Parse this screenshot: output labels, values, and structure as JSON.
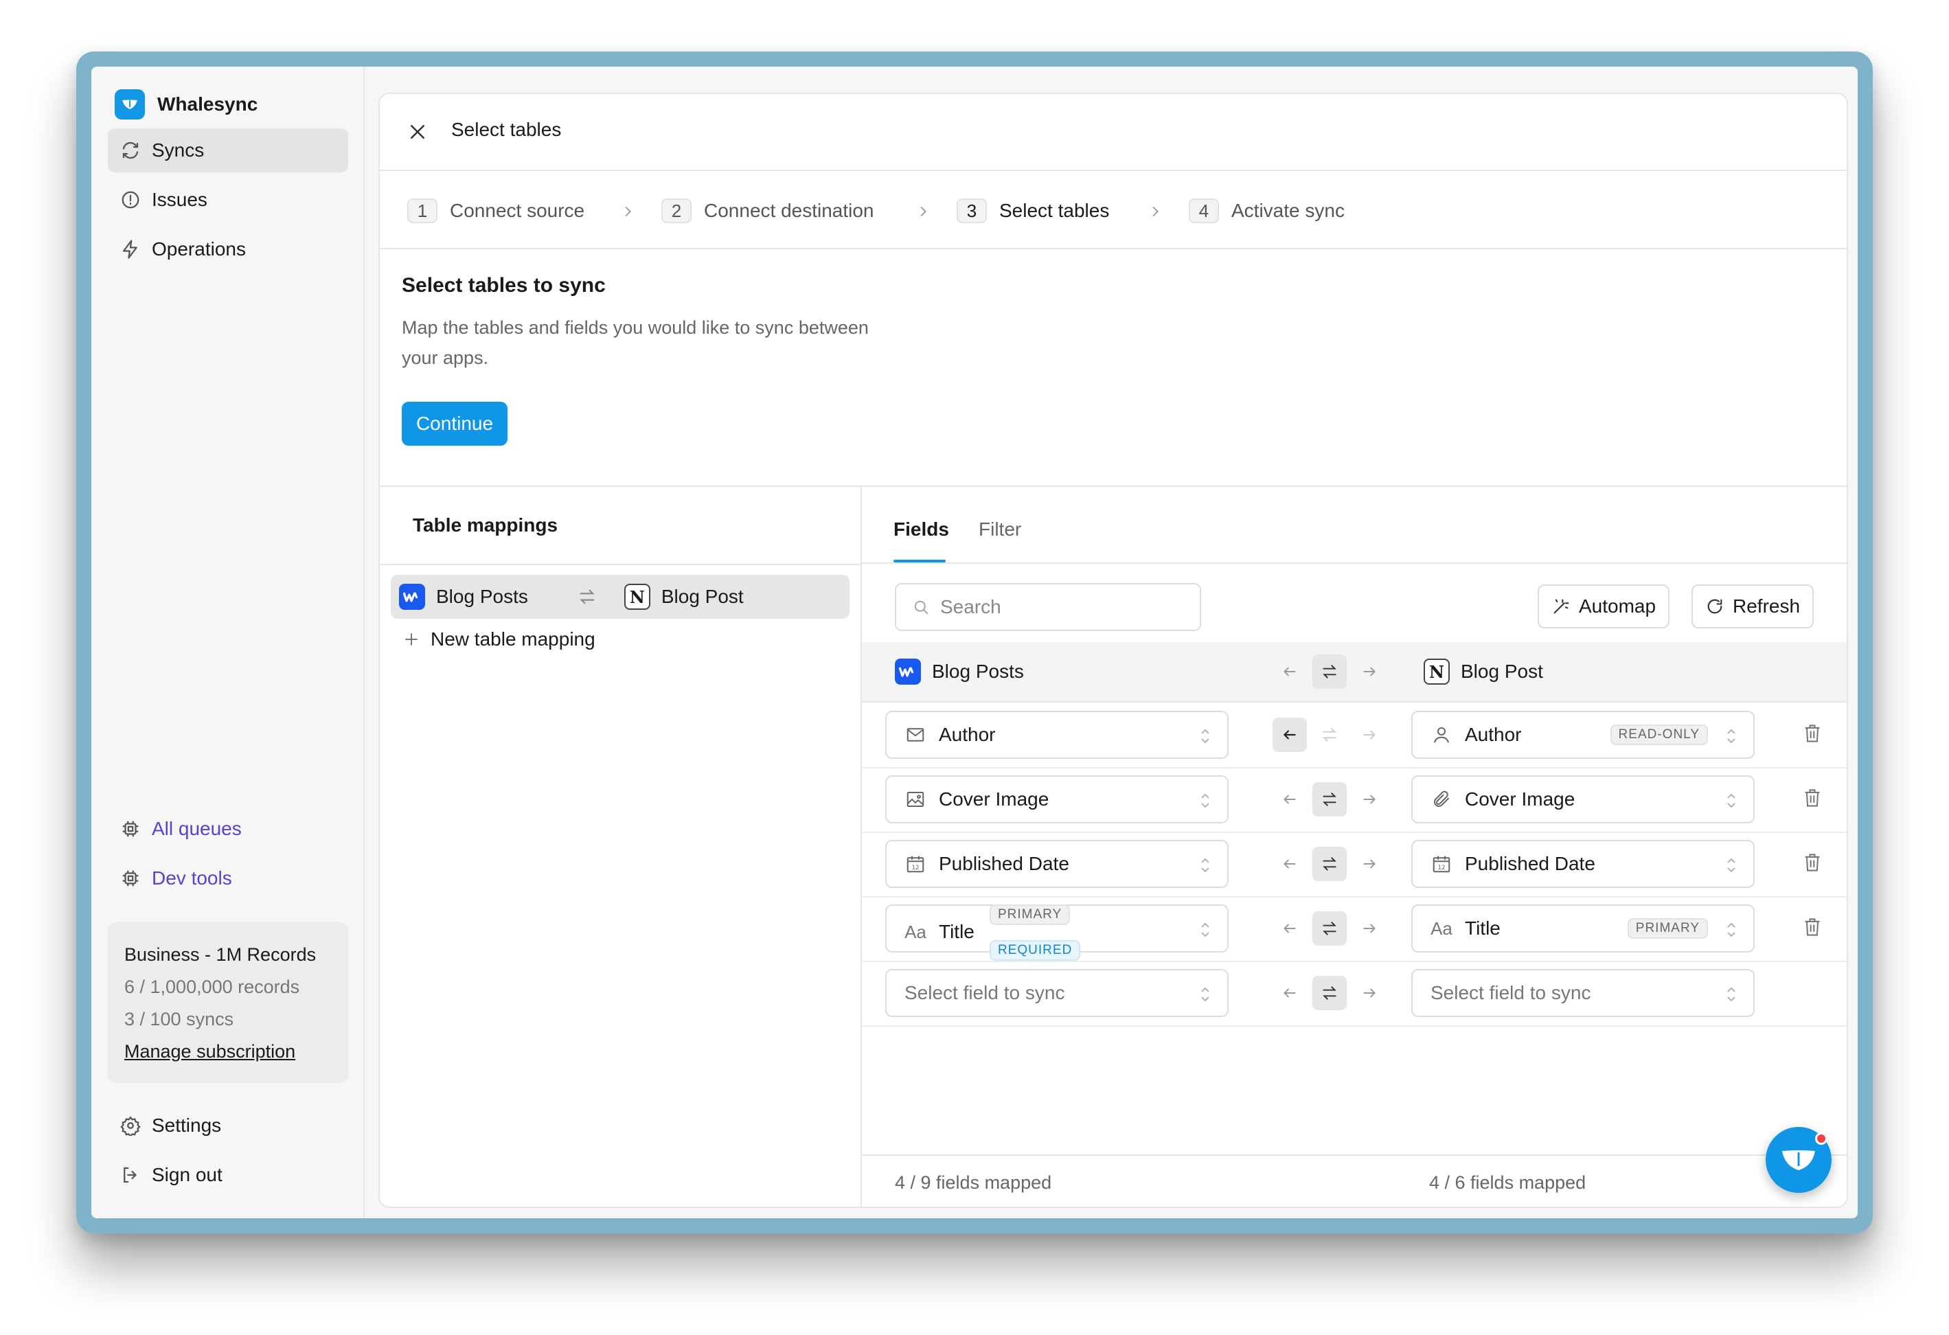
{
  "app": {
    "name": "Whalesync"
  },
  "sidebar": {
    "items": [
      {
        "label": "Syncs",
        "icon": "sync-icon",
        "active": true
      },
      {
        "label": "Issues",
        "icon": "alert-circle-icon"
      },
      {
        "label": "Operations",
        "icon": "lightning-icon"
      }
    ],
    "dev_links": [
      {
        "label": "All queues",
        "icon": "chip-icon"
      },
      {
        "label": "Dev tools",
        "icon": "chip-icon"
      }
    ],
    "plan": {
      "name": "Business - 1M Records",
      "records": "6 / 1,000,000 records",
      "syncs": "3 / 100 syncs",
      "manage": "Manage subscription"
    },
    "bottom": [
      {
        "label": "Settings",
        "icon": "gear-icon"
      },
      {
        "label": "Sign out",
        "icon": "sign-out-icon"
      }
    ]
  },
  "dialog": {
    "title": "Select tables",
    "steps": [
      {
        "num": "1",
        "label": "Connect source"
      },
      {
        "num": "2",
        "label": "Connect destination"
      },
      {
        "num": "3",
        "label": "Select tables",
        "current": true
      },
      {
        "num": "4",
        "label": "Activate sync"
      }
    ],
    "heading": "Select tables to sync",
    "description": "Map the tables and fields you would like to sync between your apps.",
    "continue_label": "Continue"
  },
  "mappings": {
    "title": "Table mappings",
    "rows": [
      {
        "left": "Blog Posts",
        "right": "Blog Post"
      }
    ],
    "new_label": "New table mapping"
  },
  "fields_panel": {
    "tabs": [
      "Fields",
      "Filter"
    ],
    "search_placeholder": "Search",
    "automap_label": "Automap",
    "refresh_label": "Refresh",
    "left_table": "Blog Posts",
    "right_table": "Blog Post",
    "rows": [
      {
        "left": "Author",
        "left_icon": "mail-icon",
        "right": "Author",
        "right_icon": "user-icon",
        "right_badge": "READ-ONLY"
      },
      {
        "left": "Cover Image",
        "left_icon": "image-icon",
        "right": "Cover Image",
        "right_icon": "paperclip-icon"
      },
      {
        "left": "Published Date",
        "left_icon": "calendar-icon",
        "right": "Published Date",
        "right_icon": "calendar-icon"
      },
      {
        "left": "Title",
        "left_icon": "text-icon",
        "left_badge": "PRIMARY",
        "left_badge2": "REQUIRED",
        "right": "Title",
        "right_icon": "text-icon",
        "right_badge": "PRIMARY"
      }
    ],
    "placeholder": "Select field to sync",
    "text_icon_glyph": "Aa",
    "calendar_day": "12",
    "left_count": "4 / 9 fields mapped",
    "right_count": "4 / 6 fields mapped"
  },
  "colors": {
    "accent": "#0f96e6",
    "link_purple": "#5b3fd0",
    "webflow_blue": "#1a59f0"
  }
}
